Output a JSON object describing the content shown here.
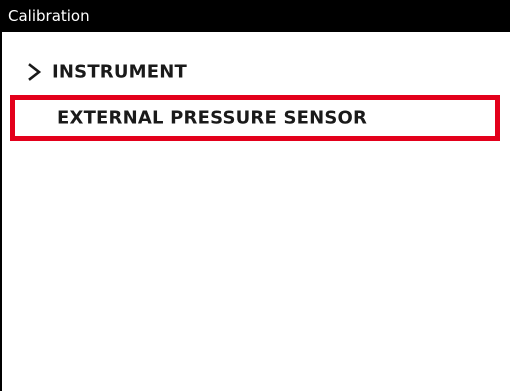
{
  "window": {
    "title": "Calibration"
  },
  "menu": {
    "items": [
      {
        "label": "INSTRUMENT",
        "icon": "chevron-right-icon",
        "selected": false
      },
      {
        "label": "EXTERNAL PRESSURE SENSOR",
        "icon": "",
        "selected": true
      }
    ]
  },
  "colors": {
    "title_bar_bg": "#000000",
    "title_text": "#ffffff",
    "highlight_border": "#e3001b",
    "item_text": "#1a1a1a",
    "background": "#ffffff"
  }
}
